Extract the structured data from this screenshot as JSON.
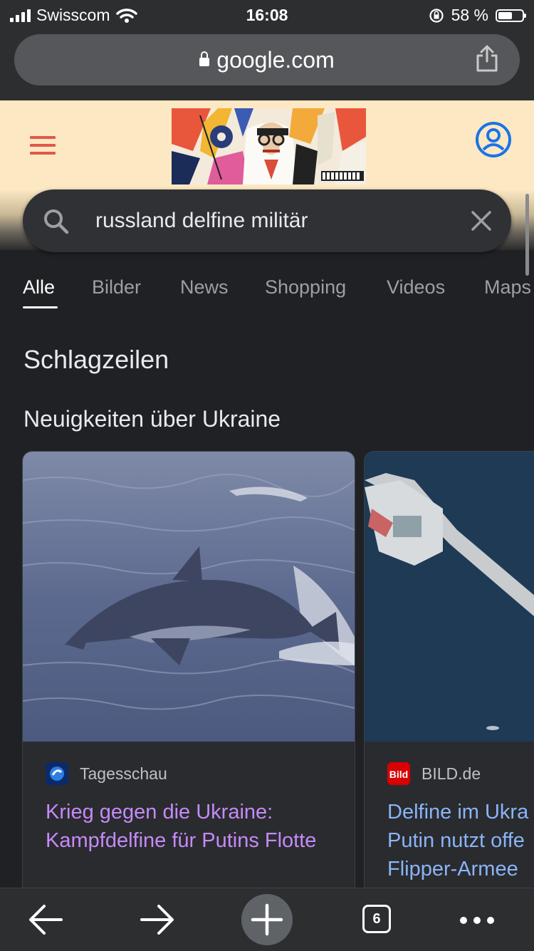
{
  "status": {
    "carrier": "Swisscom",
    "time": "16:08",
    "battery": "58 %",
    "battery_level": 0.58
  },
  "urlbar": {
    "domain": "google.com"
  },
  "search": {
    "query": "russland delfine militär"
  },
  "tabs": [
    {
      "label": "Alle",
      "active": true
    },
    {
      "label": "Bilder",
      "active": false
    },
    {
      "label": "News",
      "active": false
    },
    {
      "label": "Shopping",
      "active": false
    },
    {
      "label": "Videos",
      "active": false
    },
    {
      "label": "Maps",
      "active": false
    }
  ],
  "sections": {
    "headlines_title": "Schlagzeilen",
    "topic_title": "Neuigkeiten über Ukraine"
  },
  "cards": [
    {
      "source": "Tagesschau",
      "headline": "Krieg gegen die Ukraine: Kampfdelfine für Putins Flotte",
      "image": "dolphin-jumping-photo"
    },
    {
      "source": "BILD.de",
      "favicon_text": "Bild",
      "headline_lines": [
        "Delfine im Ukra",
        "Putin nutzt offe",
        "Flipper-Armee"
      ],
      "image": "aerial-harbor-photo"
    }
  ],
  "toolbar": {
    "tab_count": "6"
  },
  "colors": {
    "background": "#202124",
    "visited_link": "#c58af9",
    "link": "#8ab4f8",
    "header_bg": "#fce8c3",
    "hamburger": "#e0584a",
    "account": "#1a73e8"
  }
}
